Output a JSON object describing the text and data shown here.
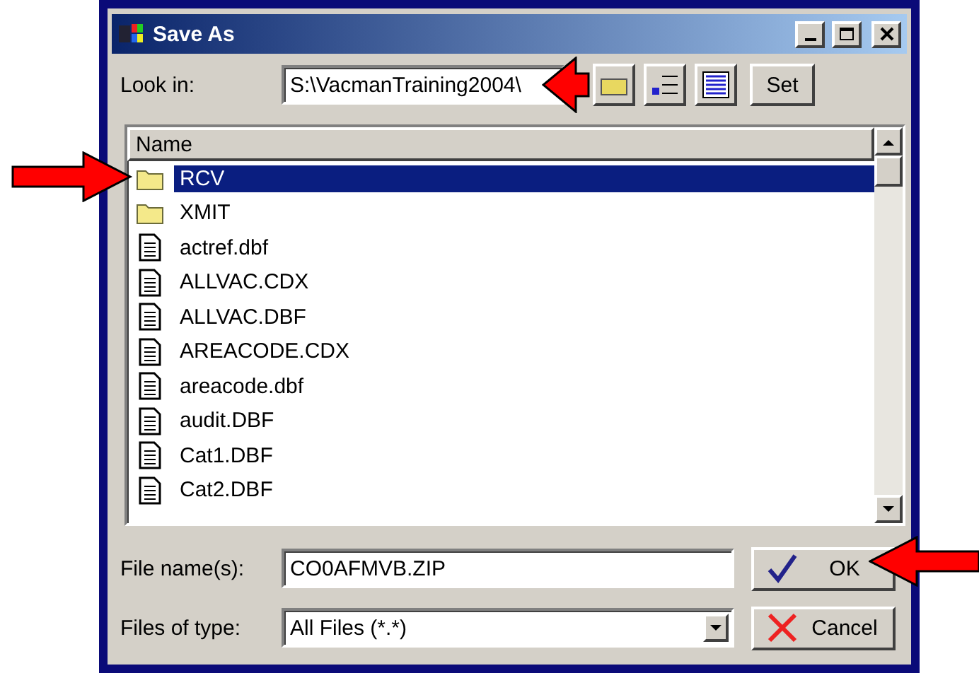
{
  "window": {
    "title": "Save As"
  },
  "look_in": {
    "label": "Look in:",
    "value": "S:\\VacmanTraining2004\\",
    "button": "Set"
  },
  "file_list": {
    "column": "Name",
    "items": [
      {
        "name": "RCV",
        "kind": "folder",
        "selected": true
      },
      {
        "name": "XMIT",
        "kind": "folder",
        "selected": false
      },
      {
        "name": "actref.dbf",
        "kind": "file",
        "selected": false
      },
      {
        "name": "ALLVAC.CDX",
        "kind": "file",
        "selected": false
      },
      {
        "name": "ALLVAC.DBF",
        "kind": "file",
        "selected": false
      },
      {
        "name": "AREACODE.CDX",
        "kind": "file",
        "selected": false
      },
      {
        "name": "areacode.dbf",
        "kind": "file",
        "selected": false
      },
      {
        "name": "audit.DBF",
        "kind": "file",
        "selected": false
      },
      {
        "name": "Cat1.DBF",
        "kind": "file",
        "selected": false
      },
      {
        "name": "Cat2.DBF",
        "kind": "file",
        "selected": false
      }
    ]
  },
  "file_name": {
    "label": "File name(s):",
    "value": "CO0AFMVB.ZIP"
  },
  "file_type": {
    "label": "Files of type:",
    "value": "All Files (*.*)"
  },
  "buttons": [
    {
      "label": "OK",
      "kind": "ok"
    },
    {
      "label": "Cancel",
      "kind": "cancel"
    }
  ]
}
